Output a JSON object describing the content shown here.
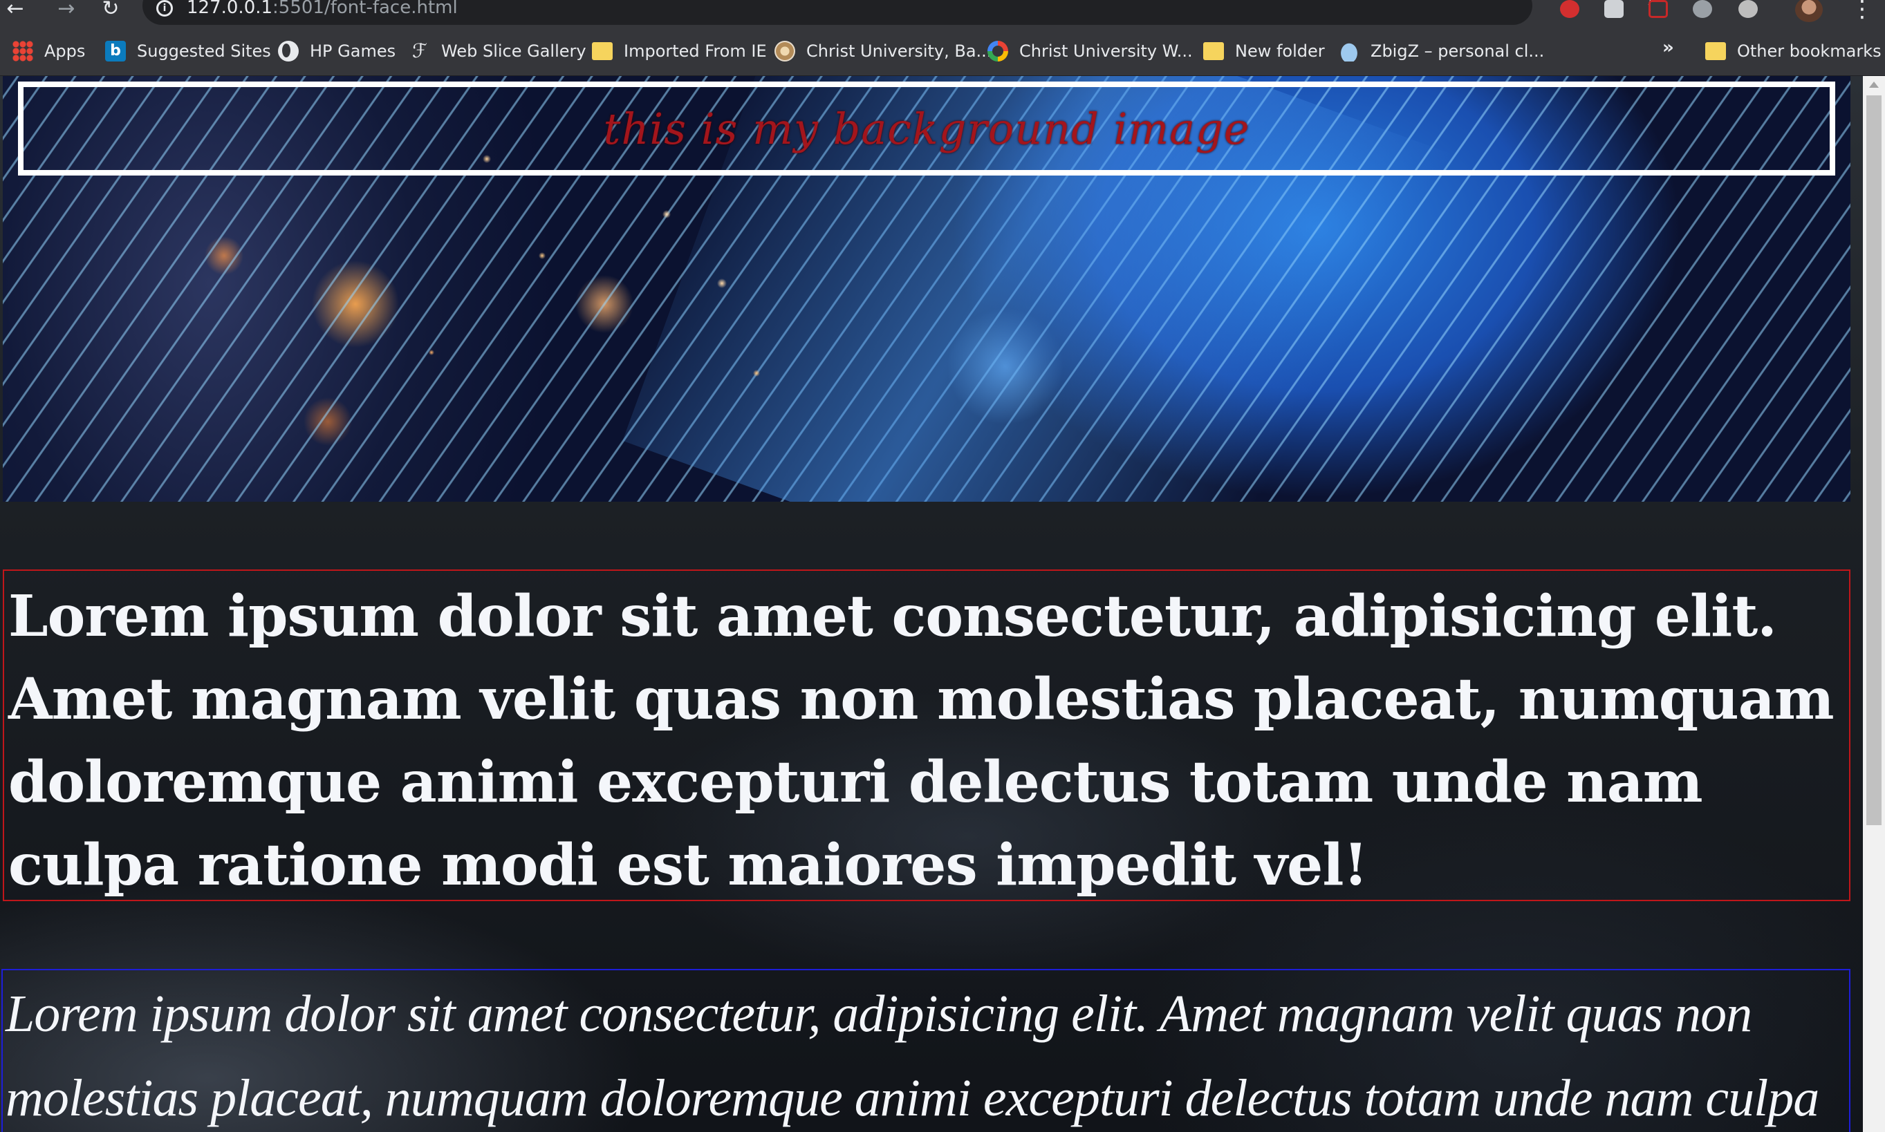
{
  "browser": {
    "url_host": "127.0.0.1",
    "url_rest": ":5501/font-face.html",
    "bookmarks": [
      {
        "label": "Apps",
        "icon": "apps-grid-icon"
      },
      {
        "label": "Suggested Sites",
        "icon": "bing-icon"
      },
      {
        "label": "HP Games",
        "icon": "globe-icon"
      },
      {
        "label": "Web Slice Gallery",
        "icon": "web-slice-icon"
      },
      {
        "label": "Imported From IE",
        "icon": "folder-icon"
      },
      {
        "label": "Christ University, Ba...",
        "icon": "university-seal-icon"
      },
      {
        "label": "Christ University W...",
        "icon": "google-icon"
      },
      {
        "label": "New folder",
        "icon": "folder-icon"
      },
      {
        "label": "ZbigZ – personal cl...",
        "icon": "cloud-icon"
      }
    ],
    "overflow_label": "»",
    "other_bookmarks": "Other bookmarks"
  },
  "page": {
    "banner_text": "this is my background image",
    "paragraph_1": "Lorem ipsum dolor sit amet consectetur, adipisicing elit. Amet magnam velit quas non molestias placeat, numquam doloremque animi excepturi delectus totam unde nam culpa ratione modi est maiores impedit vel!",
    "paragraph_2": "Lorem ipsum dolor sit amet consectetur, adipisicing elit. Amet magnam velit quas non molestias placeat, numquam doloremque animi excepturi delectus totam unde nam culpa ratione modi est"
  },
  "colors": {
    "banner_text": "#a3151c",
    "paragraph_1_border": "#c0161a",
    "paragraph_2_border": "#1e1ed8"
  }
}
